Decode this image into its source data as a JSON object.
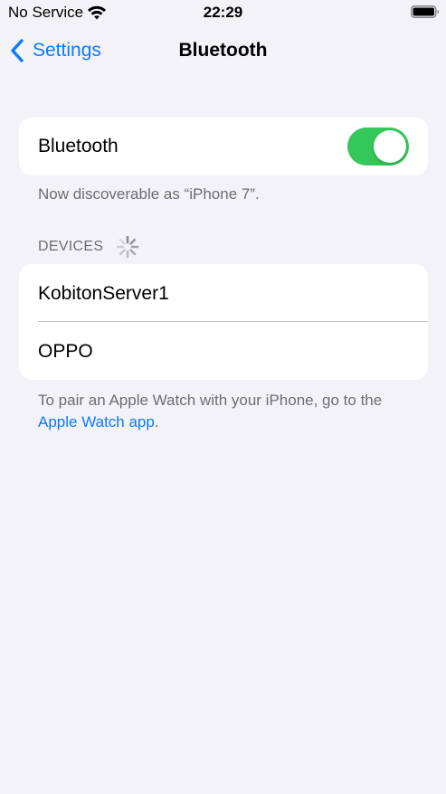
{
  "status_bar": {
    "carrier": "No Service",
    "time": "22:29",
    "icons": [
      "wifi-icon",
      "battery-icon"
    ]
  },
  "nav": {
    "back_label": "Settings",
    "title": "Bluetooth"
  },
  "bluetooth": {
    "label": "Bluetooth",
    "enabled": true,
    "discoverable_text": "Now discoverable as “iPhone 7”."
  },
  "devices": {
    "header": "DEVICES",
    "items": [
      {
        "name": "KobitonServer1"
      },
      {
        "name": "OPPO"
      }
    ]
  },
  "pair_note": {
    "text": "To pair an Apple Watch with your iPhone, go to the ",
    "link": "Apple Watch app",
    "suffix": "."
  },
  "colors": {
    "accent": "#0a7aff",
    "toggle_on": "#34c759",
    "background": "#f2f2f7",
    "secondary_text": "#6d6d72"
  }
}
